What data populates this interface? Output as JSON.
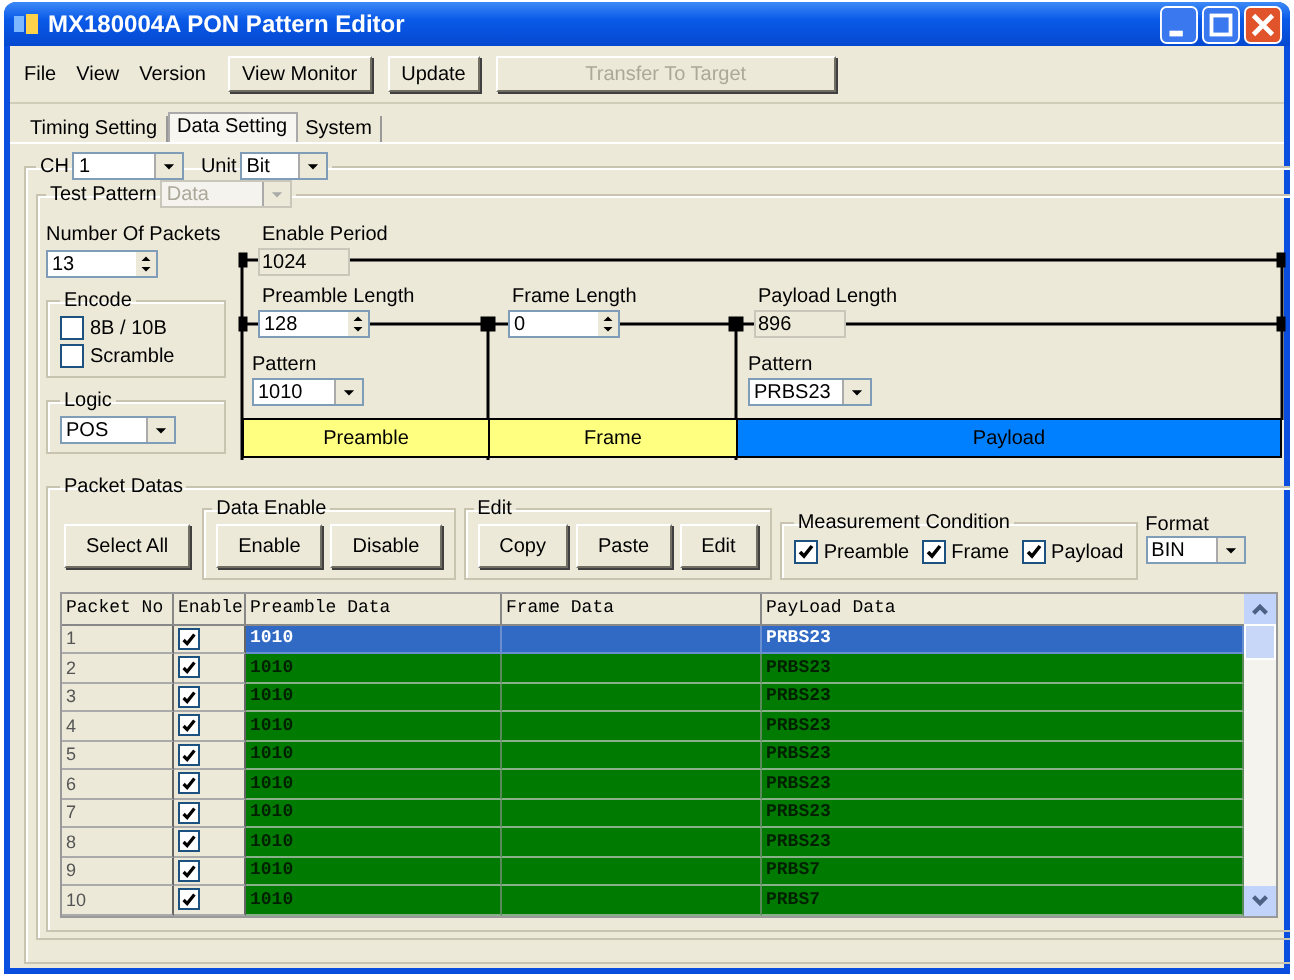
{
  "window": {
    "title": "MX180004A PON Pattern Editor"
  },
  "menu": [
    {
      "label": "File"
    },
    {
      "label": "View"
    },
    {
      "label": "Version"
    }
  ],
  "toolbar": [
    {
      "label": "View Monitor",
      "disabled": false
    },
    {
      "label": "Update",
      "disabled": false
    },
    {
      "label": "Transfer To Target",
      "disabled": true
    }
  ],
  "tabs": [
    {
      "label": "Timing Setting",
      "selected": false
    },
    {
      "label": "Data Setting",
      "selected": true
    },
    {
      "label": "System",
      "selected": false
    }
  ],
  "channel": {
    "label": "CH",
    "value": "1"
  },
  "unit": {
    "label": "Unit",
    "value": "Bit"
  },
  "test_pattern": {
    "label": "Test Pattern",
    "value": "Data",
    "disabled": true
  },
  "packets": {
    "label": "Number Of Packets",
    "value": "13"
  },
  "encode": {
    "label": "Encode",
    "options": [
      {
        "label": "8B / 10B",
        "checked": false
      },
      {
        "label": "Scramble",
        "checked": false
      }
    ]
  },
  "logic": {
    "label": "Logic",
    "value": "POS"
  },
  "diagram": {
    "enable_period": {
      "label": "Enable Period",
      "value": "1024"
    },
    "preamble_length": {
      "label": "Preamble Length",
      "value": "128"
    },
    "frame_length": {
      "label": "Frame Length",
      "value": "0"
    },
    "payload_length": {
      "label": "Payload Length",
      "value": "896"
    },
    "preamble_pattern": {
      "label": "Pattern",
      "value": "1010"
    },
    "payload_pattern": {
      "label": "Pattern",
      "value": "PRBS23"
    },
    "segments": [
      {
        "label": "Preamble",
        "color": "#ffff80"
      },
      {
        "label": "Frame",
        "color": "#ffff80"
      },
      {
        "label": "Payload",
        "color": "#0080ff"
      }
    ]
  },
  "packet_datas": {
    "label": "Packet Datas",
    "select_all": "Select All",
    "data_enable": {
      "label": "Data Enable",
      "buttons": [
        "Enable",
        "Disable"
      ]
    },
    "edit": {
      "label": "Edit",
      "buttons": [
        "Copy",
        "Paste",
        "Edit"
      ]
    },
    "measurement": {
      "label": "Measurement Condition",
      "options": [
        {
          "label": "Preamble",
          "checked": true
        },
        {
          "label": "Frame",
          "checked": true
        },
        {
          "label": "Payload",
          "checked": true
        }
      ]
    },
    "format": {
      "label": "Format",
      "value": "BIN"
    }
  },
  "table": {
    "columns": [
      "Packet No",
      "Enable",
      "Preamble Data",
      "Frame Data",
      "PayLoad Data"
    ],
    "rows": [
      {
        "no": "1",
        "enabled": true,
        "preamble": "1010",
        "payload": "PRBS23",
        "selected": true
      },
      {
        "no": "2",
        "enabled": true,
        "preamble": "1010",
        "payload": "PRBS23",
        "selected": false
      },
      {
        "no": "3",
        "enabled": true,
        "preamble": "1010",
        "payload": "PRBS23",
        "selected": false
      },
      {
        "no": "4",
        "enabled": true,
        "preamble": "1010",
        "payload": "PRBS23",
        "selected": false
      },
      {
        "no": "5",
        "enabled": true,
        "preamble": "1010",
        "payload": "PRBS23",
        "selected": false
      },
      {
        "no": "6",
        "enabled": true,
        "preamble": "1010",
        "payload": "PRBS23",
        "selected": false
      },
      {
        "no": "7",
        "enabled": true,
        "preamble": "1010",
        "payload": "PRBS23",
        "selected": false
      },
      {
        "no": "8",
        "enabled": true,
        "preamble": "1010",
        "payload": "PRBS23",
        "selected": false
      },
      {
        "no": "9",
        "enabled": true,
        "preamble": "1010",
        "payload": "PRBS7",
        "selected": false
      },
      {
        "no": "10",
        "enabled": true,
        "preamble": "1010",
        "payload": "PRBS7",
        "selected": false
      }
    ]
  }
}
